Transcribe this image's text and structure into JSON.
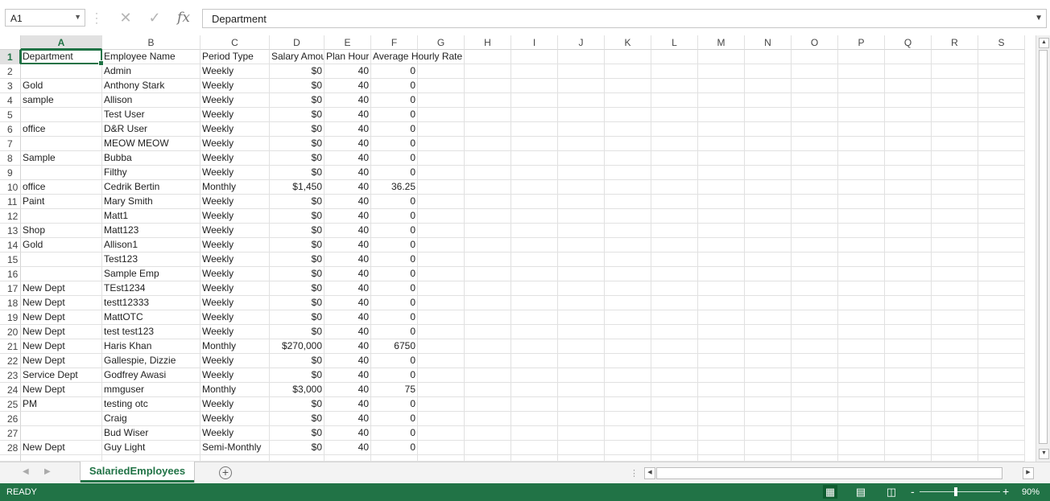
{
  "name_box": {
    "value": "A1"
  },
  "formula_bar": {
    "cancel_glyph": "✕",
    "enter_glyph": "✓",
    "fx_label": "fx",
    "content": "Department"
  },
  "columns": [
    "A",
    "B",
    "C",
    "D",
    "E",
    "F",
    "G",
    "H",
    "I",
    "J",
    "K",
    "L",
    "M",
    "N",
    "O",
    "P",
    "Q",
    "R",
    "S"
  ],
  "selected": {
    "column": "A",
    "row": "1"
  },
  "rows": [
    {
      "n": "1",
      "a": "Department",
      "b": "Employee Name",
      "c": "Period Type",
      "d": "Salary Amou",
      "e": "Plan Hour",
      "f": "Average Hourly Rate",
      "header": true
    },
    {
      "n": "2",
      "a": "",
      "b": "Admin",
      "c": "Weekly",
      "d": "$0",
      "e": "40",
      "f": "0"
    },
    {
      "n": "3",
      "a": "Gold",
      "b": "Anthony Stark",
      "c": "Weekly",
      "d": "$0",
      "e": "40",
      "f": "0"
    },
    {
      "n": "4",
      "a": "sample",
      "b": "Allison",
      "c": "Weekly",
      "d": "$0",
      "e": "40",
      "f": "0"
    },
    {
      "n": "5",
      "a": "",
      "b": "Test User",
      "c": "Weekly",
      "d": "$0",
      "e": "40",
      "f": "0"
    },
    {
      "n": "6",
      "a": "office",
      "b": "D&R User",
      "c": "Weekly",
      "d": "$0",
      "e": "40",
      "f": "0"
    },
    {
      "n": "7",
      "a": "",
      "b": "MEOW MEOW",
      "c": "Weekly",
      "d": "$0",
      "e": "40",
      "f": "0"
    },
    {
      "n": "8",
      "a": "Sample",
      "b": "Bubba",
      "c": "Weekly",
      "d": "$0",
      "e": "40",
      "f": "0"
    },
    {
      "n": "9",
      "a": "",
      "b": "Filthy",
      "c": "Weekly",
      "d": "$0",
      "e": "40",
      "f": "0"
    },
    {
      "n": "10",
      "a": "office",
      "b": "Cedrik Bertin",
      "c": "Monthly",
      "d": "$1,450",
      "e": "40",
      "f": "36.25"
    },
    {
      "n": "11",
      "a": "Paint",
      "b": "Mary Smith",
      "c": "Weekly",
      "d": "$0",
      "e": "40",
      "f": "0"
    },
    {
      "n": "12",
      "a": "",
      "b": "Matt1",
      "c": "Weekly",
      "d": "$0",
      "e": "40",
      "f": "0"
    },
    {
      "n": "13",
      "a": "Shop",
      "b": "Matt123",
      "c": "Weekly",
      "d": "$0",
      "e": "40",
      "f": "0"
    },
    {
      "n": "14",
      "a": "Gold",
      "b": "Allison1",
      "c": "Weekly",
      "d": "$0",
      "e": "40",
      "f": "0"
    },
    {
      "n": "15",
      "a": "",
      "b": "Test123",
      "c": "Weekly",
      "d": "$0",
      "e": "40",
      "f": "0"
    },
    {
      "n": "16",
      "a": "",
      "b": "Sample Emp",
      "c": "Weekly",
      "d": "$0",
      "e": "40",
      "f": "0"
    },
    {
      "n": "17",
      "a": "New Dept",
      "b": "TEst1234",
      "c": "Weekly",
      "d": "$0",
      "e": "40",
      "f": "0"
    },
    {
      "n": "18",
      "a": "New Dept",
      "b": "testt12333",
      "c": "Weekly",
      "d": "$0",
      "e": "40",
      "f": "0"
    },
    {
      "n": "19",
      "a": "New Dept",
      "b": "MattOTC",
      "c": "Weekly",
      "d": "$0",
      "e": "40",
      "f": "0"
    },
    {
      "n": "20",
      "a": "New Dept",
      "b": "test test123",
      "c": "Weekly",
      "d": "$0",
      "e": "40",
      "f": "0"
    },
    {
      "n": "21",
      "a": "New Dept",
      "b": "Haris Khan",
      "c": "Monthly",
      "d": "$270,000",
      "e": "40",
      "f": "6750"
    },
    {
      "n": "22",
      "a": "New Dept",
      "b": "Gallespie, Dizzie",
      "c": "Weekly",
      "d": "$0",
      "e": "40",
      "f": "0"
    },
    {
      "n": "23",
      "a": "Service Dept",
      "b": "Godfrey Awasi",
      "c": "Weekly",
      "d": "$0",
      "e": "40",
      "f": "0"
    },
    {
      "n": "24",
      "a": "New Dept",
      "b": "mmguser",
      "c": "Monthly",
      "d": "$3,000",
      "e": "40",
      "f": "75"
    },
    {
      "n": "25",
      "a": "PM",
      "b": "testing otc",
      "c": "Weekly",
      "d": "$0",
      "e": "40",
      "f": "0"
    },
    {
      "n": "26",
      "a": "",
      "b": "Craig",
      "c": "Weekly",
      "d": "$0",
      "e": "40",
      "f": "0"
    },
    {
      "n": "27",
      "a": "",
      "b": "Bud Wiser",
      "c": "Weekly",
      "d": "$0",
      "e": "40",
      "f": "0"
    },
    {
      "n": "28",
      "a": "New Dept",
      "b": "Guy Light",
      "c": "Semi-Monthly",
      "d": "$0",
      "e": "40",
      "f": "0"
    }
  ],
  "sheet_tabs": {
    "active": "SalariedEmployees",
    "add_glyph": "+"
  },
  "status_bar": {
    "mode": "READY",
    "zoom": "90%",
    "zoom_minus": "-",
    "zoom_plus": "+"
  },
  "colors": {
    "accent": "#217346",
    "header_sel_bg": "#e1e1e1",
    "grid_line": "#e1e1e1"
  },
  "icons": [
    "name-box-dropdown-icon",
    "cancel-icon",
    "enter-icon",
    "fx-icon",
    "expand-formula-icon",
    "add-sheet-icon",
    "normal-view-icon",
    "page-layout-icon",
    "page-break-icon"
  ]
}
